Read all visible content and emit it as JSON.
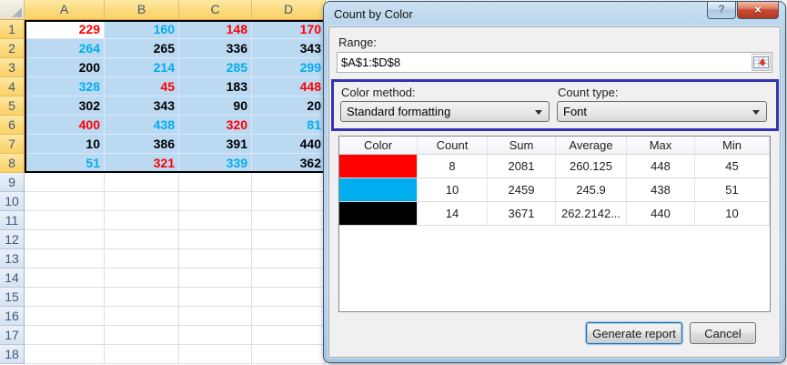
{
  "sheet": {
    "col_headers": [
      "A",
      "B",
      "C",
      "D"
    ],
    "row_headers": [
      "1",
      "2",
      "3",
      "4",
      "5",
      "6",
      "7",
      "8",
      "9",
      "10",
      "11",
      "12",
      "13",
      "14",
      "15",
      "16",
      "17",
      "18"
    ],
    "cells": [
      [
        {
          "v": "229",
          "c": "red"
        },
        {
          "v": "160",
          "c": "blue"
        },
        {
          "v": "148",
          "c": "red"
        },
        {
          "v": "170",
          "c": "red"
        }
      ],
      [
        {
          "v": "264",
          "c": "blue"
        },
        {
          "v": "265",
          "c": "black"
        },
        {
          "v": "336",
          "c": "black"
        },
        {
          "v": "343",
          "c": "black"
        }
      ],
      [
        {
          "v": "200",
          "c": "black"
        },
        {
          "v": "214",
          "c": "blue"
        },
        {
          "v": "285",
          "c": "blue"
        },
        {
          "v": "299",
          "c": "blue"
        }
      ],
      [
        {
          "v": "328",
          "c": "blue"
        },
        {
          "v": "45",
          "c": "red"
        },
        {
          "v": "183",
          "c": "black"
        },
        {
          "v": "448",
          "c": "red"
        }
      ],
      [
        {
          "v": "302",
          "c": "black"
        },
        {
          "v": "343",
          "c": "black"
        },
        {
          "v": "90",
          "c": "black"
        },
        {
          "v": "20",
          "c": "black"
        }
      ],
      [
        {
          "v": "400",
          "c": "red"
        },
        {
          "v": "438",
          "c": "blue"
        },
        {
          "v": "320",
          "c": "red"
        },
        {
          "v": "81",
          "c": "blue"
        }
      ],
      [
        {
          "v": "10",
          "c": "black"
        },
        {
          "v": "386",
          "c": "black"
        },
        {
          "v": "391",
          "c": "black"
        },
        {
          "v": "440",
          "c": "black"
        }
      ],
      [
        {
          "v": "51",
          "c": "blue"
        },
        {
          "v": "321",
          "c": "red"
        },
        {
          "v": "339",
          "c": "blue"
        },
        {
          "v": "362",
          "c": "black"
        }
      ]
    ],
    "font_colors": {
      "red": "#FF0000",
      "blue": "#00AEEF",
      "black": "#000000"
    }
  },
  "dialog": {
    "title": "Count by Color",
    "help_glyph": "?",
    "close_glyph": "×",
    "range_label": "Range:",
    "range_value": "$A$1:$D$8",
    "color_method_label": "Color method:",
    "color_method_value": "Standard formatting",
    "count_type_label": "Count type:",
    "count_type_value": "Font",
    "table": {
      "headers": [
        "Color",
        "Count",
        "Sum",
        "Average",
        "Max",
        "Min"
      ],
      "rows": [
        {
          "swatch": "red",
          "count": "8",
          "sum": "2081",
          "average": "260.125",
          "max": "448",
          "min": "45"
        },
        {
          "swatch": "blue",
          "count": "10",
          "sum": "2459",
          "average": "245.9",
          "max": "438",
          "min": "51"
        },
        {
          "swatch": "black",
          "count": "14",
          "sum": "3671",
          "average": "262.2142...",
          "max": "440",
          "min": "10"
        }
      ],
      "swatch_colors": {
        "red": "#FF0000",
        "blue": "#00AEEF",
        "black": "#000000"
      }
    },
    "generate_button": "Generate report",
    "cancel_button": "Cancel"
  },
  "icons": {
    "select_all": "select-all-corner-triangle",
    "range_picker": "range-select-grid-with-red-arrow",
    "combo_arrow": "triangle-down",
    "help": "question-mark",
    "close": "close-x"
  }
}
